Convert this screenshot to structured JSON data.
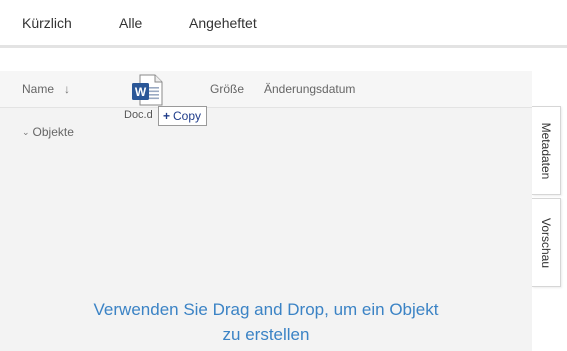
{
  "tabs": [
    {
      "label": "Kürzlich"
    },
    {
      "label": "Alle"
    },
    {
      "label": "Angeheftet"
    }
  ],
  "columns": {
    "name": "Name",
    "sort_indicator": "↓",
    "size": "Größe",
    "date": "Änderungsdatum"
  },
  "groups": [
    {
      "chevron": "⌄",
      "label": "Objekte"
    }
  ],
  "drop_hint": {
    "line1": "Verwenden Sie Drag and Drop, um ein Objekt",
    "line2": "zu erstellen"
  },
  "drag": {
    "icon": "word-document-icon",
    "icon_letter": "W",
    "file_label": "Doc.d",
    "badge_plus": "+",
    "badge_label": "Copy"
  },
  "side_panel": {
    "metadata": "Metadaten",
    "preview": "Vorschau"
  },
  "colors": {
    "accent_blue": "#3b83c5",
    "word_blue": "#2b5797",
    "panel_bg": "#f3f3f3"
  }
}
